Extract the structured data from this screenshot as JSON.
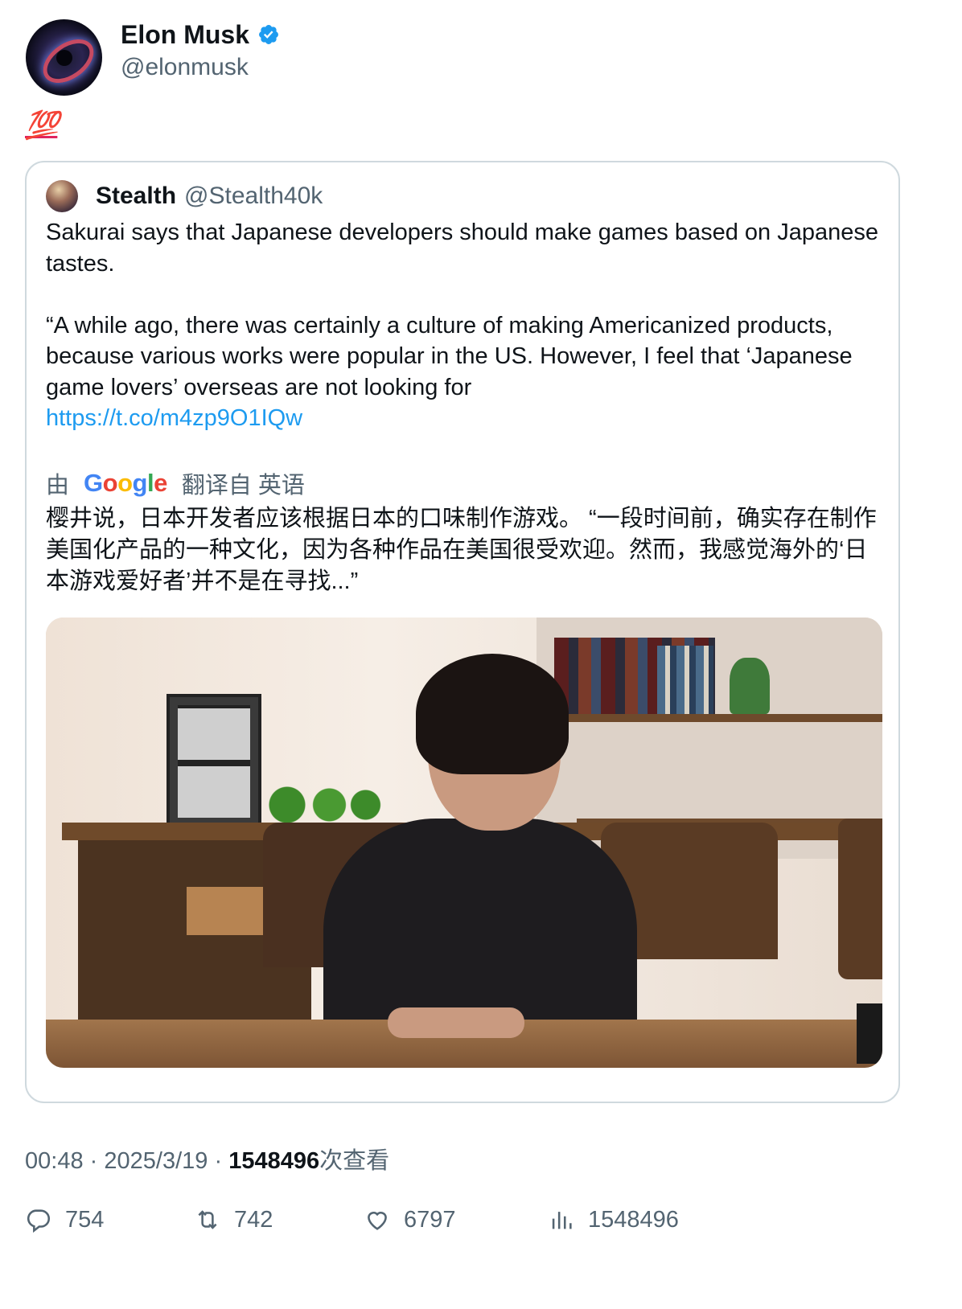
{
  "author": {
    "name": "Elon Musk",
    "handle": "@elonmusk",
    "verified_color": "#1d9bf0"
  },
  "tweet": {
    "text": "💯"
  },
  "quote": {
    "author_name": "Stealth",
    "author_handle": "@Stealth40k",
    "paragraph1": "Sakurai says that Japanese developers should make games based on Japanese tastes.",
    "paragraph2": "“A while ago, there was certainly a culture of making Americanized products, because various works were popular in the US. However, I feel that ‘Japanese game lovers’ overseas are not looking for",
    "link": "https://t.co/m4zp9O1IQw",
    "translated_prefix": "由",
    "translated_brand": "Google",
    "translated_suffix": "翻译自 英语",
    "translation": "樱井说，日本开发者应该根据日本的口味制作游戏。 “一段时间前，确实存在制作美国化产品的一种文化，因为各种作品在美国很受欢迎。然而，我感觉海外的‘日本游戏爱好者’并不是在寻找...”"
  },
  "meta": {
    "time": "00:48",
    "separator": "·",
    "date": "2025/3/19",
    "views": "1548496",
    "views_suffix": "次查看"
  },
  "actions": {
    "replies": "754",
    "reposts": "742",
    "likes": "6797",
    "views": "1548496"
  }
}
